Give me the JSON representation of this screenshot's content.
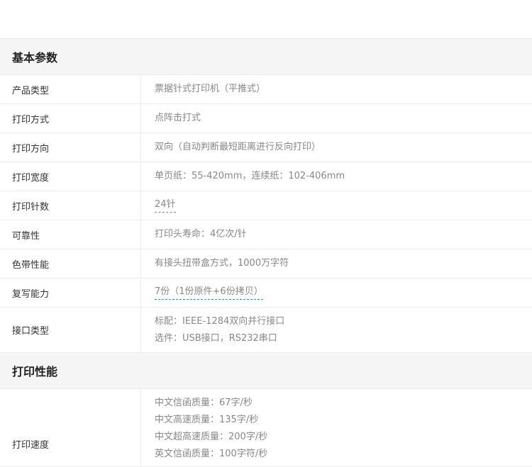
{
  "sections": [
    {
      "title": "基本参数",
      "rows": [
        {
          "label": "产品类型",
          "values": [
            "票据针式打印机（平推式）"
          ]
        },
        {
          "label": "打印方式",
          "values": [
            "点阵击打式"
          ]
        },
        {
          "label": "打印方向",
          "values": [
            "双向（自动判断最短距离进行反向打印）"
          ]
        },
        {
          "label": "打印宽度",
          "values": [
            "单页纸：55-420mm，连续纸：102-406mm"
          ]
        },
        {
          "label": "打印针数",
          "values": [
            "24针"
          ]
        },
        {
          "label": "可靠性",
          "values": [
            "打印头寿命：4亿次/针"
          ]
        },
        {
          "label": "色带性能",
          "values": [
            "有接头扭带盒方式，1000万字符"
          ]
        },
        {
          "label": "复写能力",
          "values": [
            "7份（1份原件+6份拷贝）"
          ]
        },
        {
          "label": "接口类型",
          "values": [
            "标配：IEEE-1284双向并行接口",
            "选件：USB接口，RS232串口"
          ]
        }
      ]
    },
    {
      "title": "打印性能",
      "rows": [
        {
          "label": "打印速度",
          "values": [
            "中文信函质量：67字/秒",
            "中文高速质量：135字/秒",
            "中文超高速质量：200字/秒",
            "英文信函质量：100字符/秒"
          ]
        }
      ]
    }
  ]
}
